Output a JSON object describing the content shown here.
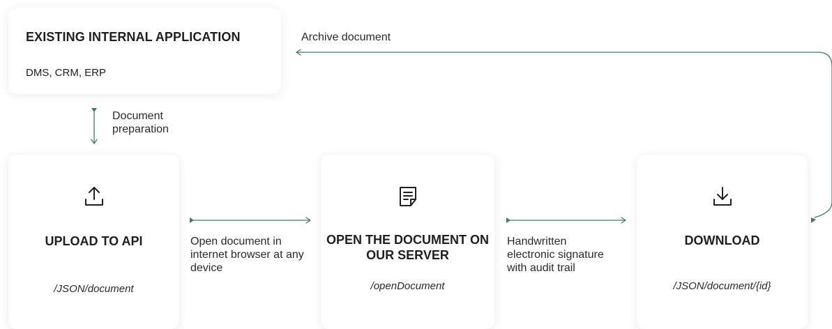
{
  "existing": {
    "title": "EXISTING INTERNAL APPLICATION",
    "subtitle": "DMS, CRM, ERP"
  },
  "labels": {
    "archive": "Archive document",
    "preparation": "Document preparation",
    "browser": "Open document in internet browser at any device",
    "signature": "Handwritten electronic signature with audit trail"
  },
  "steps": [
    {
      "icon": "upload-icon",
      "title": "UPLOAD TO API",
      "path": "/JSON/document"
    },
    {
      "icon": "document-icon",
      "title": "OPEN THE DOCUMENT ON OUR SERVER",
      "path": "/openDocument"
    },
    {
      "icon": "download-icon",
      "title": "DOWNLOAD",
      "path": "/JSON/document/{id}"
    }
  ],
  "colors": {
    "accent": "#3d7d5e",
    "text": "#1f1f1f"
  }
}
